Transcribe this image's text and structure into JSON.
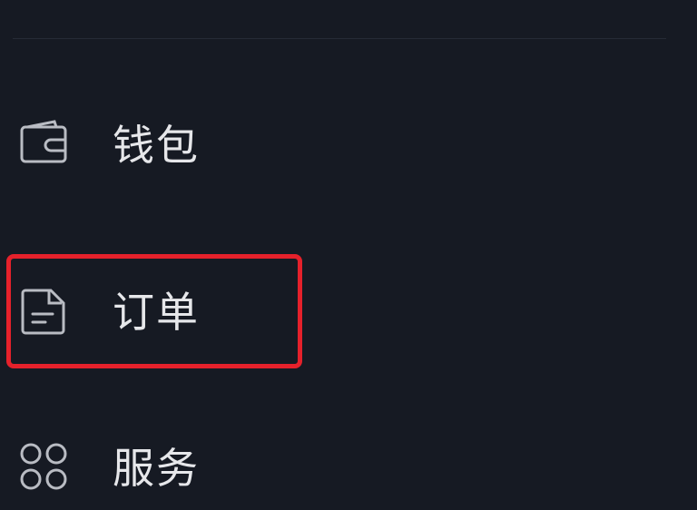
{
  "menu": {
    "items": [
      {
        "label": "钱包",
        "icon": "wallet-icon"
      },
      {
        "label": "订单",
        "icon": "order-document-icon",
        "highlighted": true
      },
      {
        "label": "服务",
        "icon": "services-icon"
      }
    ]
  },
  "colors": {
    "background": "#161a23",
    "text": "#e6e7ea",
    "icon": "#b9bcc3",
    "highlight": "#e5212b"
  }
}
